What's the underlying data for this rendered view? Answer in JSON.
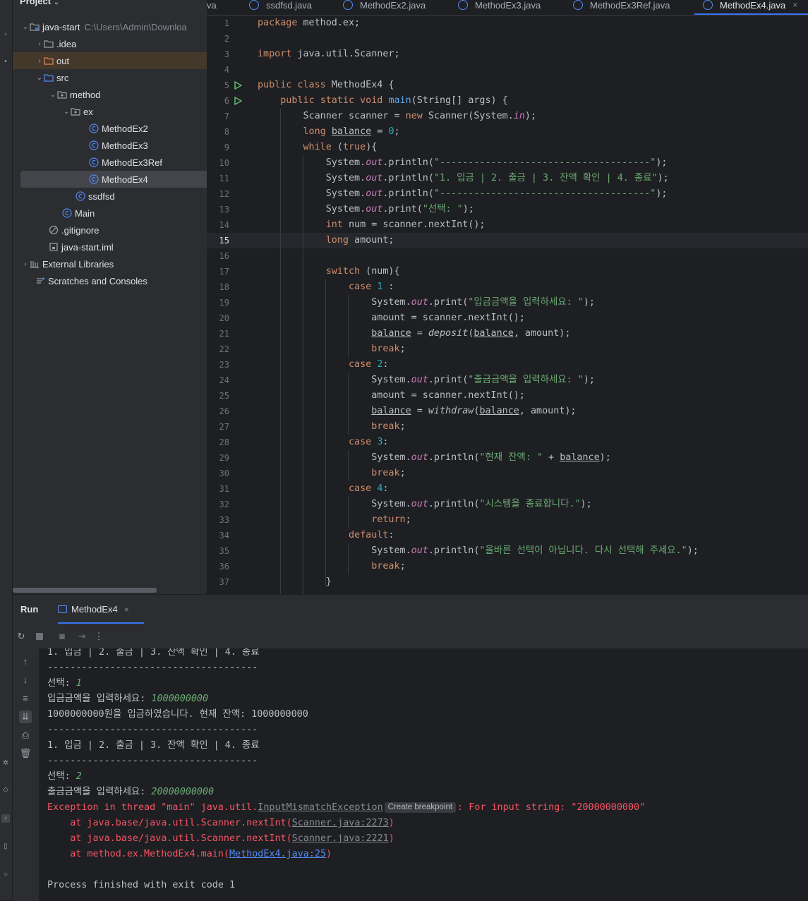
{
  "project": {
    "header": "Project",
    "tree": [
      {
        "label": "java-start",
        "hint": "C:\\Users\\Admin\\Downloa",
        "kind": "module-folder",
        "expanded": true
      },
      {
        "label": ".idea",
        "kind": "folder",
        "expanded": false
      },
      {
        "label": "out",
        "kind": "folder-orange",
        "expanded": false
      },
      {
        "label": "src",
        "kind": "folder-src",
        "expanded": true
      },
      {
        "label": "method",
        "kind": "package",
        "expanded": true
      },
      {
        "label": "ex",
        "kind": "package",
        "expanded": true
      },
      {
        "label": "MethodEx2",
        "kind": "class"
      },
      {
        "label": "MethodEx3",
        "kind": "class"
      },
      {
        "label": "MethodEx3Ref",
        "kind": "class"
      },
      {
        "label": "MethodEx4",
        "kind": "class",
        "selected": true
      },
      {
        "label": "ssdfsd",
        "kind": "class"
      },
      {
        "label": "Main",
        "kind": "class"
      },
      {
        "label": ".gitignore",
        "kind": "ignore-file"
      },
      {
        "label": "java-start.iml",
        "kind": "iml-file"
      },
      {
        "label": "External Libraries",
        "kind": "libraries",
        "expanded": false
      },
      {
        "label": "Scratches and Consoles",
        "kind": "scratches"
      }
    ]
  },
  "tabs": [
    {
      "label": "va"
    },
    {
      "label": "ssdfsd.java"
    },
    {
      "label": "MethodEx2.java"
    },
    {
      "label": "MethodEx3.java"
    },
    {
      "label": "MethodEx3Ref.java"
    },
    {
      "label": "MethodEx4.java",
      "active": true
    }
  ],
  "editor": {
    "line_numbers": [
      "1",
      "2",
      "3",
      "4",
      "5",
      "6",
      "7",
      "8",
      "9",
      "10",
      "11",
      "12",
      "13",
      "14",
      "15",
      "16",
      "17",
      "18",
      "19",
      "20",
      "21",
      "22",
      "23",
      "24",
      "25",
      "26",
      "27",
      "28",
      "29",
      "30",
      "31",
      "32",
      "33",
      "34",
      "35",
      "36",
      "37"
    ],
    "current_line": "15",
    "code": [
      "package method.ex;",
      "",
      "import java.util.Scanner;",
      "",
      "public class MethodEx4 {",
      "    public static void main(String[] args) {",
      "        Scanner scanner = new Scanner(System.in);",
      "        long balance = 0;",
      "        while (true){",
      "            System.out.println(\"-------------------------------------\");",
      "            System.out.println(\"1. 입금 | 2. 출금 | 3. 잔액 확인 | 4. 종료\");",
      "            System.out.println(\"-------------------------------------\");",
      "            System.out.print(\"선택: \");",
      "            int num = scanner.nextInt();",
      "            long amount;",
      "",
      "            switch (num){",
      "                case 1 :",
      "                    System.out.print(\"입금금액을 입력하세요: \");",
      "                    amount = scanner.nextInt();",
      "                    balance = deposit(balance, amount);",
      "                    break;",
      "                case 2:",
      "                    System.out.print(\"출금금액을 입력하세요: \");",
      "                    amount = scanner.nextInt();",
      "                    balance = withdraw(balance, amount);",
      "                    break;",
      "                case 3:",
      "                    System.out.println(\"현재 잔액: \" + balance);",
      "                    break;",
      "                case 4:",
      "                    System.out.println(\"시스템을 종료합니다.\");",
      "                    return;",
      "                default:",
      "                    System.out.println(\"올바른 선택이 아닙니다. 다시 선택해 주세요.\");",
      "                    break;",
      "            }"
    ]
  },
  "run": {
    "title": "Run",
    "tab_label": "MethodEx4",
    "console": {
      "menu_line": "1. 입금 | 2. 출금 | 3. 잔액 확인 | 4. 종료",
      "separator": "-------------------------------------",
      "select_prompt": "선택: ",
      "deposit_prompt": "입금금액을 입력하세요: ",
      "withdraw_prompt": "출금금액을 입력하세요: ",
      "input_1": "1",
      "input_deposit": "1000000000",
      "deposit_result": "1000000000원을 입금하였습니다. 현재 잔액: 1000000000",
      "input_2": "2",
      "input_withdraw": "20000000000",
      "exception_prefix": "Exception in thread \"main\" java.util.",
      "exception_class": "InputMismatchException",
      "breakpoint_chip": "Create breakpoint",
      "exception_suffix": ": For input string: \"20000000000\"",
      "trace1_prefix": "    at java.base/java.util.Scanner.nextInt(",
      "trace1_link": "Scanner.java:2273",
      "trace2_prefix": "    at java.base/java.util.Scanner.nextInt(",
      "trace2_link": "Scanner.java:2221",
      "trace3_prefix": "    at method.ex.MethodEx4.main(",
      "trace3_link": "MethodEx4.java:25",
      "close_paren": ")",
      "finished": "Process finished with exit code 1"
    }
  },
  "colors": {
    "keyword": "#cf8e6d",
    "string": "#6aab73",
    "number": "#2aacb8",
    "method_decl": "#56a8f5",
    "static_field": "#c77dbb",
    "error": "#f75464",
    "link": "#548af7",
    "accent": "#3574f0"
  },
  "icons": {
    "run_gutter": "play-triangle-icon",
    "class": "class-c-icon",
    "folder": "folder-icon",
    "package": "package-icon"
  }
}
